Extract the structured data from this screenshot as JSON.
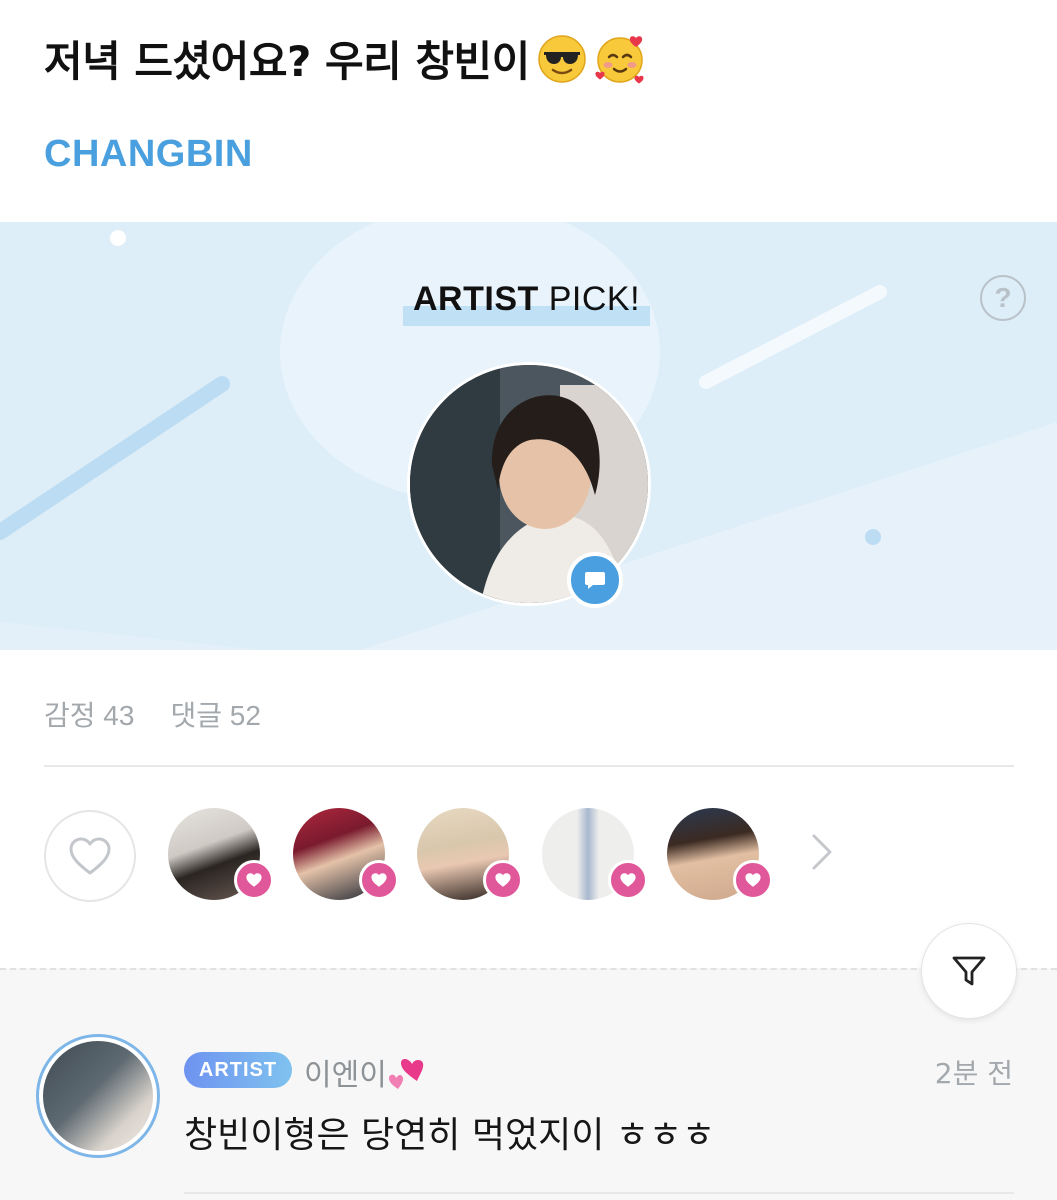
{
  "post": {
    "title": "저녁 드셨어요? 우리 창빈이",
    "title_emojis": [
      "smiling-face-with-sunglasses",
      "smiling-face-with-hearts"
    ],
    "artist": "CHANGBIN"
  },
  "artist_pick": {
    "title_bold": "ARTIST",
    "title_rest": " PICK!",
    "help_label": "?"
  },
  "stats": {
    "emotion": "감정 43",
    "comments": "댓글 52"
  },
  "reactions": {
    "avatars": [
      "reactor-1",
      "reactor-2",
      "reactor-3",
      "reactor-4",
      "reactor-5"
    ]
  },
  "comment": {
    "badge": "ARTIST",
    "author": "이엔이",
    "time": "2분 전",
    "text": "창빈이형은 당연히 먹었지이 ㅎㅎㅎ"
  },
  "colors": {
    "accent": "#4aa0de",
    "banner_bg": "#ddeef9",
    "heart_badge": "#e0579a",
    "muted_text": "#a3a8ad"
  }
}
